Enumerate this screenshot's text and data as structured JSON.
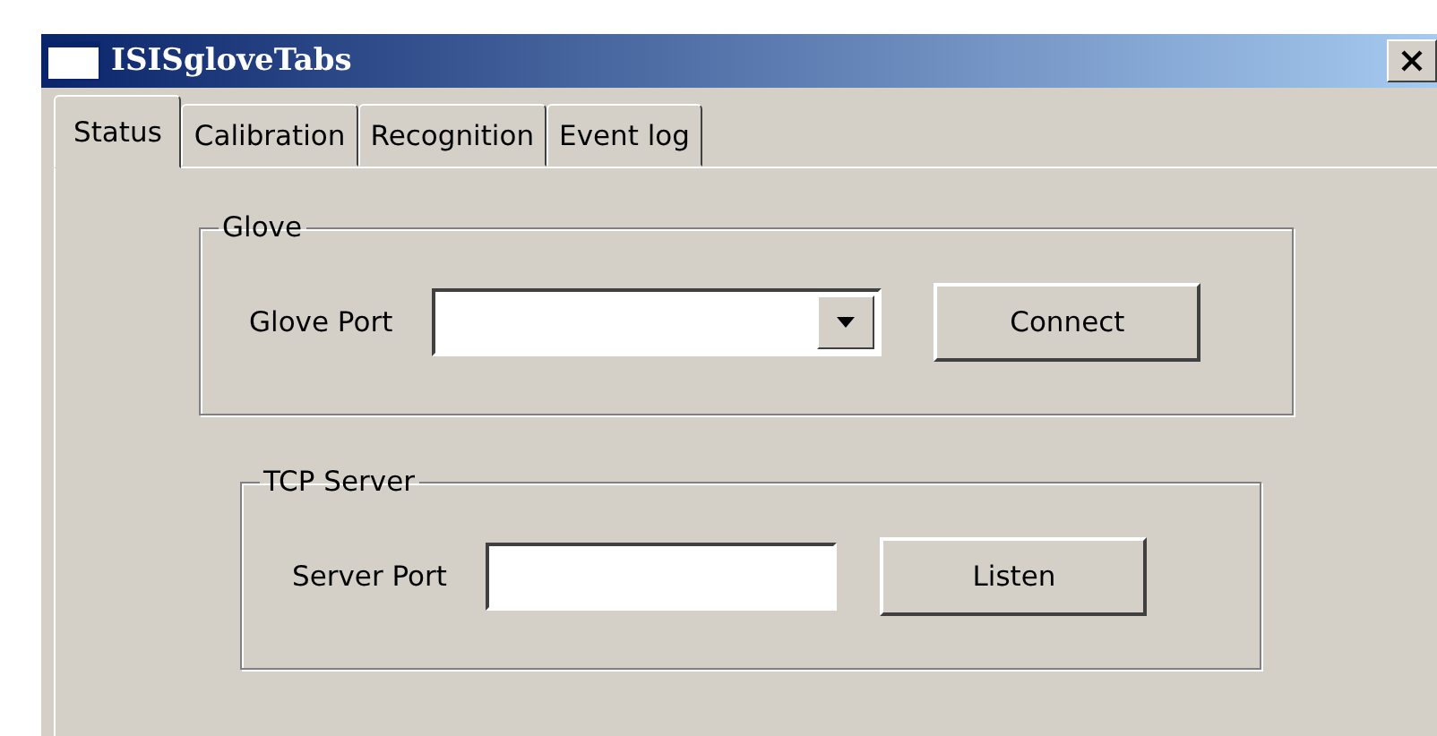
{
  "window": {
    "title": "ISISgloveTabs"
  },
  "tabs": [
    {
      "label": "Status",
      "selected": true
    },
    {
      "label": "Calibration",
      "selected": false
    },
    {
      "label": "Recognition",
      "selected": false
    },
    {
      "label": "Event log",
      "selected": false
    }
  ],
  "groups": [
    {
      "title": "Glove",
      "label": "Glove Port",
      "kind": "combo",
      "button": "Connect"
    },
    {
      "title": "TCP Server",
      "label": "Server Port",
      "kind": "text",
      "button": "Listen"
    }
  ]
}
